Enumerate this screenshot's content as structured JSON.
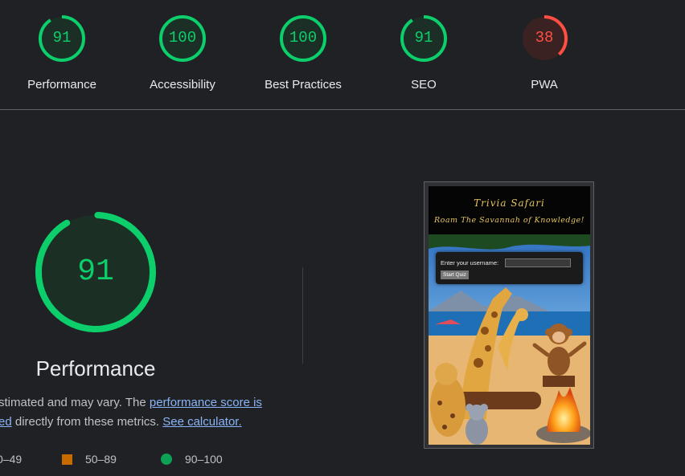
{
  "colors": {
    "pass": "#0cce6b",
    "fail": "#ff4e42",
    "average": "#c76b00",
    "background": "#202124",
    "link": "#8ab4f8"
  },
  "categories": [
    {
      "label": "Performance",
      "score": "91",
      "rating": "pass"
    },
    {
      "label": "Accessibility",
      "score": "100",
      "rating": "pass"
    },
    {
      "label": "Best Practices",
      "score": "100",
      "rating": "pass"
    },
    {
      "label": "SEO",
      "score": "91",
      "rating": "pass"
    },
    {
      "label": "PWA",
      "score": "38",
      "rating": "fail"
    }
  ],
  "main": {
    "score": "91",
    "title": "Performance",
    "desc_text1": "stimated and may vary. The ",
    "desc_link1a": "performance score is",
    "desc_link1b": "ed",
    "desc_text2": " directly from these metrics. ",
    "desc_link2": "See calculator."
  },
  "legend": {
    "fail_range": "0–49",
    "average_range": "50–89",
    "pass_range": "90–100"
  },
  "screenshot": {
    "app_title": "Trivia Safari",
    "app_subtitle": "Roam The Savannah of Knowledge!",
    "username_label": "Enter your username:",
    "start_button": "Start Quiz"
  }
}
